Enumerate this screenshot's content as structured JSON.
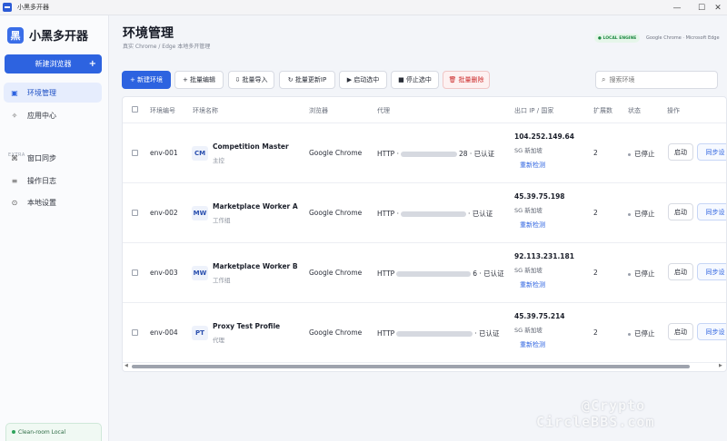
{
  "window": {
    "title": "小黑多开器"
  },
  "sidebar": {
    "brand": "小黑多开器",
    "new_button": "新建浏览器",
    "items": [
      {
        "label": "环境管理",
        "icon": "grid-icon",
        "active": true
      },
      {
        "label": "应用中心",
        "icon": "app-icon",
        "active": false
      }
    ],
    "section_label": "EXTRA",
    "extra_items": [
      {
        "label": "窗口同步",
        "icon": "sync-icon"
      },
      {
        "label": "操作日志",
        "icon": "log-icon"
      },
      {
        "label": "本地设置",
        "icon": "settings-icon"
      }
    ],
    "footer": "Clean-room Local"
  },
  "header": {
    "title": "环境管理",
    "subtitle": "真实 Chrome / Edge 本地多开管理",
    "engine_badge": "● LOCAL ENGINE",
    "engine_text": "Google Chrome · Microsoft Edge"
  },
  "toolbar": {
    "new_env": "+ 新建环境",
    "batch_edit": "+ 批量编辑",
    "batch_import": "⇩ 批量导入",
    "batch_ip": "↻ 批量更新IP",
    "start_selected": "▶ 启动选中",
    "stop_selected": "■ 停止选中",
    "batch_delete": "🗑 批量删除",
    "search_placeholder": "搜索环境"
  },
  "table": {
    "columns": [
      "环境编号",
      "环境名称",
      "浏览器",
      "代理",
      "出口 IP / 国家",
      "扩展数",
      "状态",
      "操作"
    ],
    "rows": [
      {
        "id": "env-001",
        "abbr": "CM",
        "name": "Competition Master",
        "group": "主控",
        "browser": "Google Chrome",
        "proxy_prefix": "HTTP ·",
        "proxy_suffix": "28 · 已认证",
        "ip": "104.252.149.64",
        "loc": "SG 新加坡",
        "recheck": "重新检测",
        "ext": "2",
        "status": "已停止",
        "start": "启动",
        "sync": "同步设"
      },
      {
        "id": "env-002",
        "abbr": "MW",
        "name": "Marketplace Worker A",
        "group": "工作组",
        "browser": "Google Chrome",
        "proxy_prefix": "HTTP ·",
        "proxy_suffix": "· 已认证",
        "ip": "45.39.75.198",
        "loc": "SG 新加坡",
        "recheck": "重新检测",
        "ext": "2",
        "status": "已停止",
        "start": "启动",
        "sync": "同步设"
      },
      {
        "id": "env-003",
        "abbr": "MW",
        "name": "Marketplace Worker B",
        "group": "工作组",
        "browser": "Google Chrome",
        "proxy_prefix": "HTTP",
        "proxy_suffix": "6 · 已认证",
        "ip": "92.113.231.181",
        "loc": "SG 新加坡",
        "recheck": "重新检测",
        "ext": "2",
        "status": "已停止",
        "start": "启动",
        "sync": "同步设"
      },
      {
        "id": "env-004",
        "abbr": "PT",
        "name": "Proxy Test Profile",
        "group": "代理",
        "browser": "Google Chrome",
        "proxy_prefix": "HTTP",
        "proxy_suffix": "· 已认证",
        "ip": "45.39.75.214",
        "loc": "SG 新加坡",
        "recheck": "重新检测",
        "ext": "2",
        "status": "已停止",
        "start": "启动",
        "sync": "同步设"
      }
    ]
  },
  "watermark": {
    "line1": "@Crypto",
    "line2": "CircleBBS.com"
  }
}
